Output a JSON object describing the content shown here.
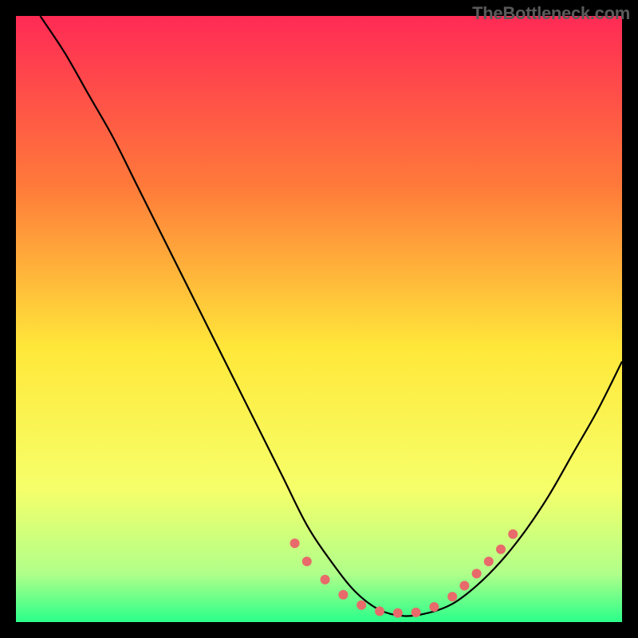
{
  "watermark": "TheBottleneck.com",
  "chart_data": {
    "type": "line",
    "title": "",
    "xlabel": "",
    "ylabel": "",
    "xlim": [
      0,
      100
    ],
    "ylim": [
      0,
      100
    ],
    "gradient_colors": {
      "top": "#ff2a55",
      "upper_mid": "#ff7a3a",
      "mid": "#ffe83a",
      "lower_mid": "#f6ff6a",
      "lower": "#b0ff8a",
      "bottom": "#2aff8a"
    },
    "curve": {
      "x": [
        4,
        8,
        12,
        16,
        20,
        24,
        28,
        32,
        36,
        40,
        44,
        48,
        52,
        56,
        60,
        64,
        68,
        72,
        76,
        80,
        84,
        88,
        92,
        96,
        100
      ],
      "y": [
        100,
        94,
        87,
        80,
        72,
        64,
        56,
        48,
        40,
        32,
        24,
        16,
        10,
        5,
        2,
        1,
        1.5,
        3,
        6,
        10,
        15,
        21,
        28,
        35,
        43
      ]
    },
    "markers": {
      "x": [
        46,
        48,
        51,
        54,
        57,
        60,
        63,
        66,
        69,
        72,
        74,
        76,
        78,
        80,
        82
      ],
      "y": [
        13,
        10,
        7,
        4.5,
        2.8,
        1.8,
        1.5,
        1.6,
        2.5,
        4.2,
        6,
        8,
        10,
        12,
        14.5
      ],
      "color": "#e86a6a",
      "radius": 6
    }
  }
}
